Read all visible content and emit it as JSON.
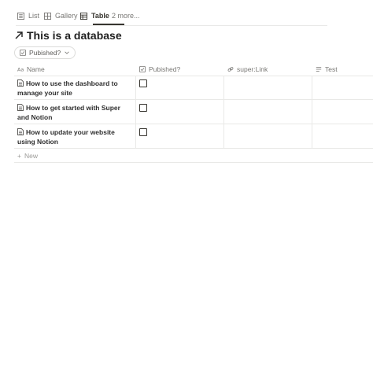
{
  "tabs": [
    {
      "label": "List",
      "icon": "list-icon"
    },
    {
      "label": "Gallery",
      "icon": "gallery-icon"
    },
    {
      "label": "Table",
      "icon": "table-icon",
      "active": true
    },
    {
      "label": "2 more...",
      "icon": ""
    }
  ],
  "page": {
    "title": "This is a database",
    "title_icon": "arrow-up-right-icon"
  },
  "filter": {
    "label": "Pubished?",
    "icon": "checkbox-icon"
  },
  "columns": [
    {
      "label": "Name",
      "icon": "text-icon"
    },
    {
      "label": "Pubished?",
      "icon": "checkbox-icon"
    },
    {
      "label": "super:Link",
      "icon": "link-icon"
    },
    {
      "label": "Test",
      "icon": "text-lines-icon"
    }
  ],
  "rows": [
    {
      "name": "How to use the dashboard to manage your site",
      "published": false
    },
    {
      "name": "How to get started with Super and Notion",
      "published": false
    },
    {
      "name": "How to update your website using Notion",
      "published": false
    }
  ],
  "new_label": "New"
}
